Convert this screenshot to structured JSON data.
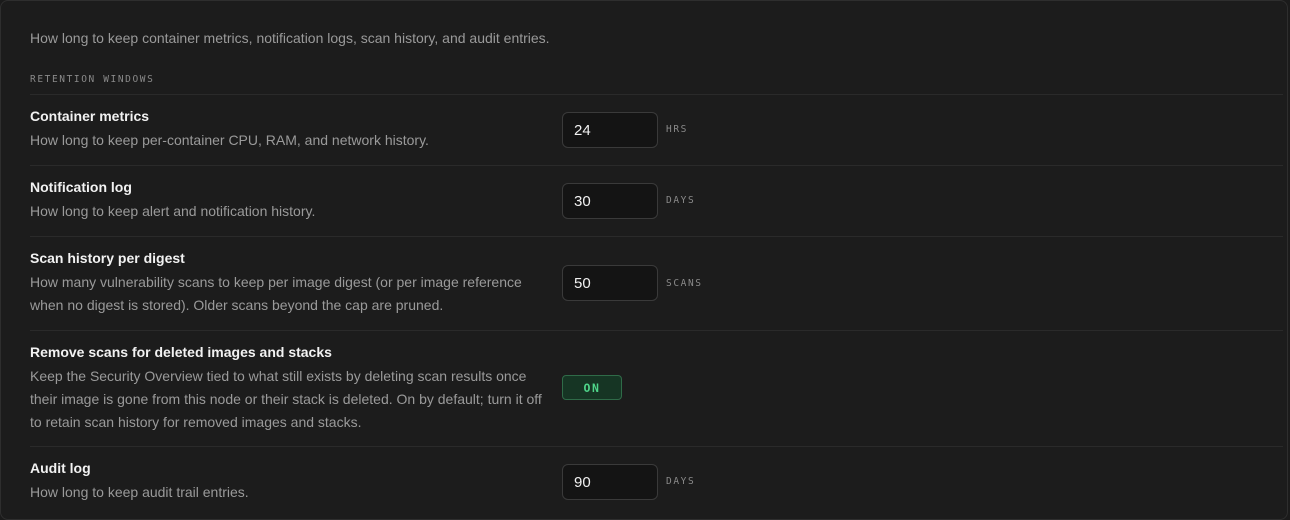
{
  "intro": "How long to keep container metrics, notification logs, scan history, and audit entries.",
  "section_heading": "RETENTION WINDOWS",
  "rows": [
    {
      "title": "Container metrics",
      "description": "How long to keep per-container CPU, RAM, and network history.",
      "value": "24",
      "unit": "HRS"
    },
    {
      "title": "Notification log",
      "description": "How long to keep alert and notification history.",
      "value": "30",
      "unit": "DAYS"
    },
    {
      "title": "Scan history per digest",
      "description": "How many vulnerability scans to keep per image digest (or per image reference when no digest is stored). Older scans beyond the cap are pruned.",
      "value": "50",
      "unit": "SCANS"
    },
    {
      "title": "Remove scans for deleted images and stacks",
      "description": "Keep the Security Overview tied to what still exists by deleting scan results once their image is gone from this node or their stack is deleted. On by default; turn it off to retain scan history for removed images and stacks.",
      "toggle_label": "ON",
      "toggle_on": true
    },
    {
      "title": "Audit log",
      "description": "How long to keep audit trail entries.",
      "value": "90",
      "unit": "DAYS"
    }
  ],
  "colors": {
    "background": "#1c1c1c",
    "toggle_on_text": "#4fd58a",
    "toggle_on_bg": "#163524"
  }
}
